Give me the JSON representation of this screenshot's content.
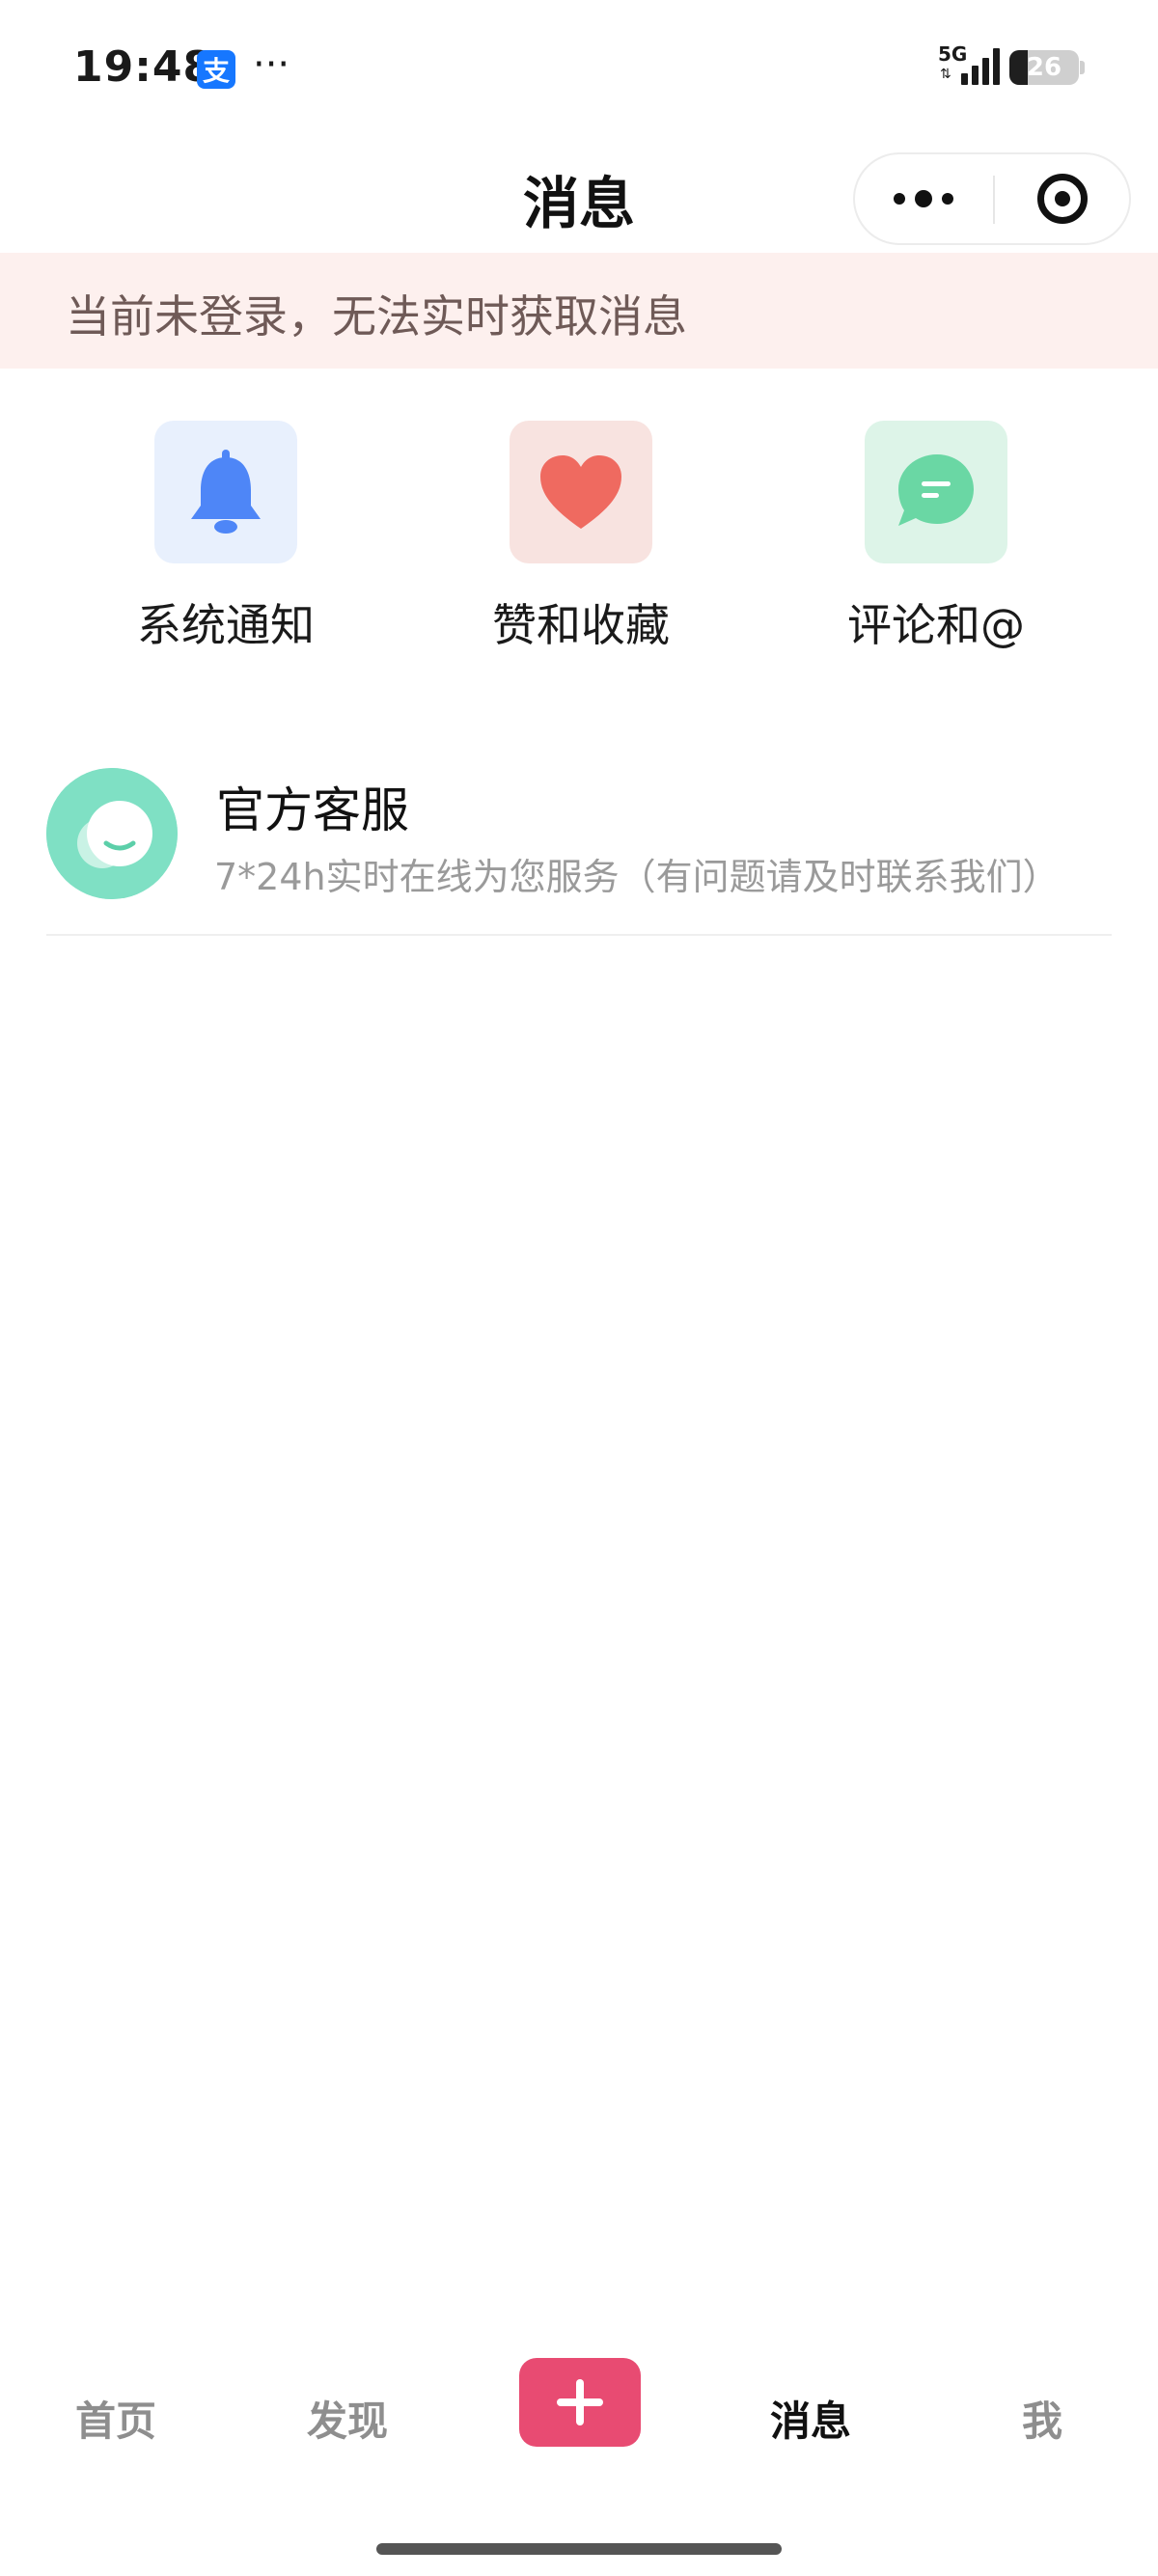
{
  "status_bar": {
    "time": "19:48",
    "app_badge": "支",
    "overflow": "···",
    "network": "5G",
    "network_arrows": "⇅",
    "battery_level": 26,
    "battery_text": "26"
  },
  "header": {
    "title": "消息"
  },
  "login_banner": {
    "text": "当前未登录，无法实时获取消息"
  },
  "categories": [
    {
      "label": "系统通知",
      "icon": "bell-icon",
      "bg": "#e8f0fd",
      "color": "#4e86f7"
    },
    {
      "label": "赞和收藏",
      "icon": "heart-icon",
      "bg": "#f8e3e0",
      "color": "#ef6a60"
    },
    {
      "label": "评论和@",
      "icon": "chat-bubble-icon",
      "bg": "#ddf4e8",
      "color": "#6ad7a4"
    }
  ],
  "service": {
    "title": "官方客服",
    "description": "7*24h实时在线为您服务（有问题请及时联系我们）",
    "icon": "smile-chat-icon",
    "color": "#7fe0c4"
  },
  "tab_bar": {
    "tabs": [
      {
        "label": "首页",
        "active": false
      },
      {
        "label": "发现",
        "active": false
      },
      {
        "label": "消息",
        "active": true
      },
      {
        "label": "我",
        "active": false
      }
    ],
    "add_icon": "plus-icon",
    "accent": "#e84b72"
  }
}
